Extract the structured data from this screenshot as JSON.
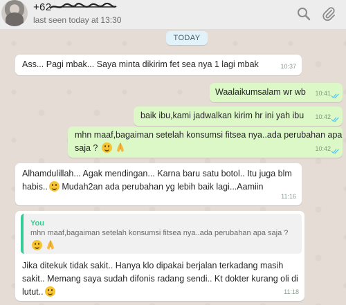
{
  "header": {
    "contact_name": "+62",
    "last_seen": "last seen today at 13:30",
    "icons": [
      "search-icon",
      "attach-icon"
    ]
  },
  "chat": {
    "date_label": "TODAY",
    "messages": [
      {
        "dir": "in",
        "text": "Ass... Pagi mbak... Saya minta dikirim fet sea nya 1 lagi mbak",
        "time": "10:37"
      },
      {
        "dir": "out",
        "text": "Waalaikumsalam wr wb",
        "time": "10:41"
      },
      {
        "dir": "out",
        "text": "baik ibu,kami jadwalkan kirim hr ini yah ibu",
        "time": "10:42"
      },
      {
        "dir": "out",
        "line1": "mhn maaf,bagaiman setelah konsumsi fitsea nya..ada perubahan apa",
        "line2": "saja ?",
        "time": "10:42"
      },
      {
        "dir": "in",
        "line1": "Alhamdulillah... Agak mendingan... Karna baru satu botol.. Itu juga blm",
        "line2a": "habis..",
        "line2b": " Mudah2an ada perubahan yg lebih baik lagi...Aamiin",
        "time": "11:16"
      },
      {
        "dir": "in",
        "quote_author": "You",
        "quote_text": "mhn maaf,bagaiman setelah konsumsi fitsea nya..ada perubahan apa saja ?",
        "line1": "Jika ditekuk tidak sakit.. Hanya klo dipakai berjalan terkadang masih",
        "line2": "sakit.. Memang saya sudah difonis radang sendi.. Kt dokter kurang oli di",
        "line3": "lutut..",
        "time": "11:18"
      }
    ]
  },
  "colors": {
    "incoming_bubble": "#ffffff",
    "outgoing_bubble": "#dcf8c6",
    "quote_accent": "#35cd96",
    "read_tick": "#4fc3f7"
  }
}
